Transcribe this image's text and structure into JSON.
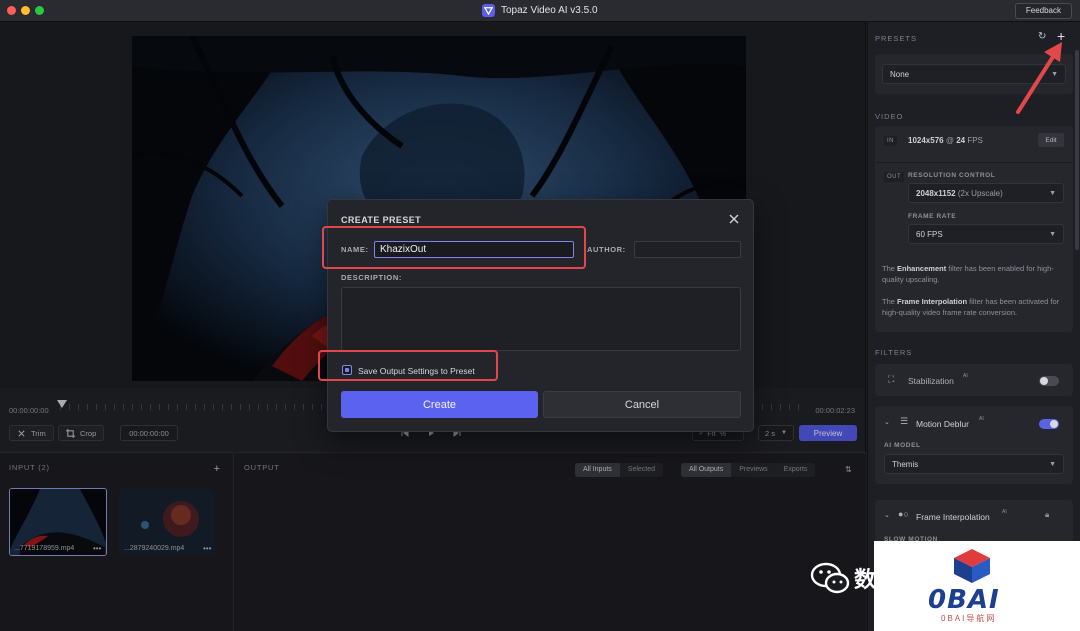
{
  "window": {
    "app_title": "Topaz Video AI  v3.5.0",
    "feedback_label": "Feedback"
  },
  "timeline": {
    "time_start": "00:00:00:00",
    "time_end": "00:00:02:23",
    "trim_label": "Trim",
    "crop_label": "Crop",
    "timecode": "00:00:00:00",
    "fit_label": "Fit",
    "fit_unit": "%",
    "seconds_label": "2 s",
    "preview_label": "Preview"
  },
  "input_panel": {
    "title": "INPUT (2)",
    "add_icon": "plus-icon",
    "files": [
      {
        "name": "...7719178959.mp4",
        "selected": true
      },
      {
        "name": "...2879240029.mp4",
        "selected": false
      }
    ]
  },
  "output_panel": {
    "title": "OUTPUT",
    "filter_a": [
      "All Inputs",
      "Selected"
    ],
    "filter_b": [
      "All Outputs",
      "Previews",
      "Exports"
    ]
  },
  "right_panel": {
    "presets_title": "PRESETS",
    "preset_value": "None",
    "video_title": "VIDEO",
    "in_tag": "IN",
    "in_resolution": "1024x576",
    "in_fps_prefix": "@",
    "in_fps": "24",
    "in_fps_unit": "FPS",
    "edit_label": "Edit",
    "out_tag": "OUT",
    "resolution_control_label": "RESOLUTION CONTROL",
    "resolution_value": "2048x1152",
    "resolution_suffix": "(2x Upscale)",
    "frame_rate_label": "FRAME RATE",
    "frame_rate_value": "60 FPS",
    "info_enhancement_pre": "The ",
    "info_enhancement_bold": "Enhancement",
    "info_enhancement_post": " filter has been enabled for high-quality upscaling.",
    "info_interp_pre": "The ",
    "info_interp_bold": "Frame Interpolation",
    "info_interp_post": " filter has been activated for high-quality video frame rate conversion.",
    "filters_title": "FILTERS",
    "stabilization_label": "Stabilization",
    "motion_deblur_label": "Motion Deblur",
    "ai_suffix": "AI",
    "ai_model_label": "AI MODEL",
    "ai_model_value": "Themis",
    "frame_interpolation_label": "Frame Interpolation",
    "slow_motion_label": "SLOW MOTION",
    "stabilization_on": false,
    "motion_deblur_on": true
  },
  "modal": {
    "title": "CREATE PRESET",
    "name_label": "NAME:",
    "name_value": "KhazixOut",
    "author_label": "AUTHOR:",
    "description_label": "DESCRIPTION:",
    "checkbox_label": "Save Output Settings to Preset",
    "checkbox_checked": true,
    "create_label": "Create",
    "cancel_label": "Cancel"
  },
  "watermark": {
    "text": "数",
    "brand": "0BAI",
    "sub": "0BAI导航网"
  },
  "colors": {
    "accent": "#5c62f0",
    "highlight": "#e2484a"
  }
}
